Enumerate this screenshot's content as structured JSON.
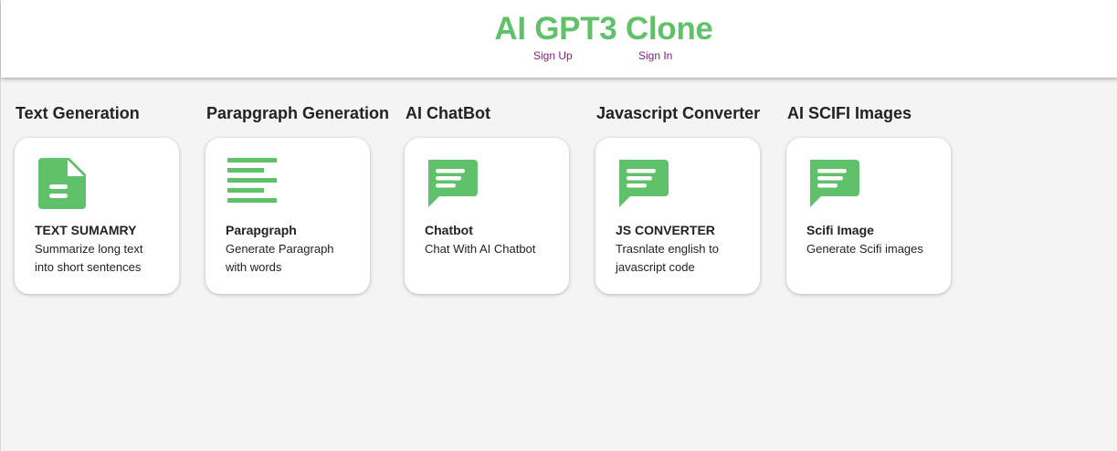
{
  "header": {
    "title": "AI GPT3 Clone",
    "nav": {
      "signup": "Sign Up",
      "signin": "Sign In"
    }
  },
  "colors": {
    "accent": "#5fc26b",
    "link": "#7b1f7b",
    "background": "#f4f4f4"
  },
  "tools": [
    {
      "heading": "Text Generation",
      "icon": "document-icon",
      "card_title": "TEXT SUMAMRY",
      "card_desc": "Summarize long text into short sentences"
    },
    {
      "heading": "Parapgraph Generation",
      "icon": "paragraph-lines-icon",
      "card_title": "Parapgraph",
      "card_desc": "Generate Paragraph with words"
    },
    {
      "heading": "AI ChatBot",
      "icon": "chat-bubble-icon",
      "card_title": "Chatbot",
      "card_desc": "Chat With AI Chatbot"
    },
    {
      "heading": "Javascript Converter",
      "icon": "chat-bubble-icon",
      "card_title": "JS CONVERTER",
      "card_desc": "Trasnlate english to javascript code"
    },
    {
      "heading": "AI SCIFI Images",
      "icon": "chat-bubble-icon",
      "card_title": "Scifi Image",
      "card_desc": "Generate Scifi images"
    }
  ]
}
